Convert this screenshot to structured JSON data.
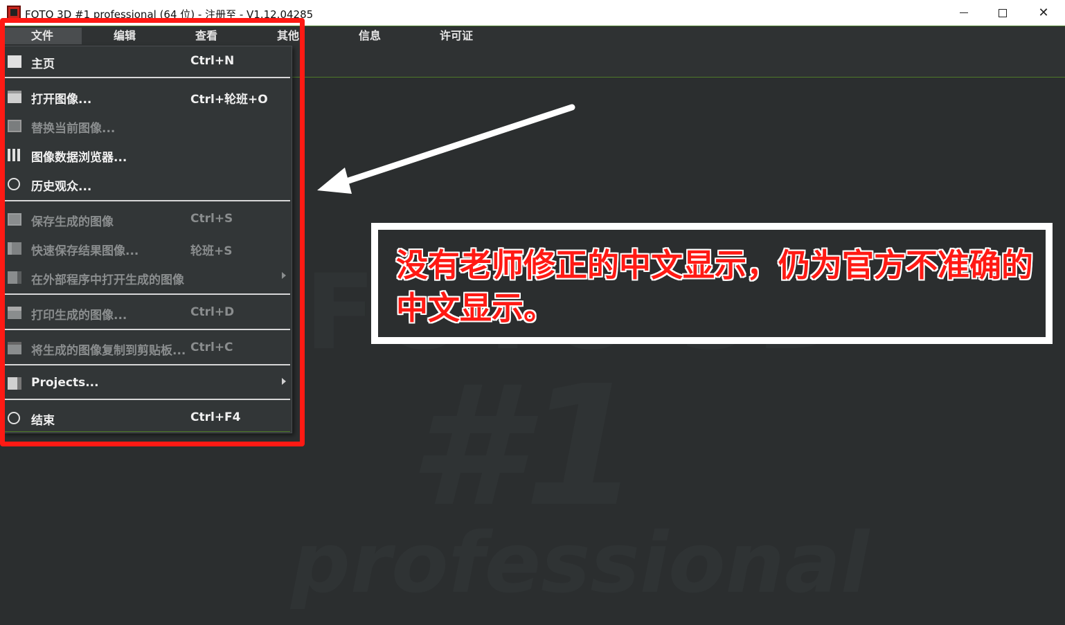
{
  "window": {
    "title": "FOTO 3D #1 professional (64 位) - 注册至 - V1.12.04285",
    "controls": {
      "minimize": "minimize-icon",
      "maximize": "maximize-icon",
      "close": "close-icon"
    }
  },
  "menubar": {
    "items": [
      {
        "label": "文件",
        "active": true
      },
      {
        "label": "编辑"
      },
      {
        "label": "查看"
      },
      {
        "label": "其他"
      },
      {
        "label": "信息"
      },
      {
        "label": "许可证"
      }
    ]
  },
  "background_logo": {
    "line1": "FOTO 3D",
    "line2": "#1",
    "line3": "professional"
  },
  "file_menu": {
    "items": [
      {
        "label": "主页",
        "shortcut": "Ctrl+N",
        "icon": "page-icon",
        "enabled": true
      },
      {
        "label": "打开图像...",
        "shortcut": "Ctrl+轮班+O",
        "icon": "folder-icon",
        "enabled": true
      },
      {
        "label": "替换当前图像...",
        "shortcut": "",
        "icon": "image-replace-icon",
        "enabled": false
      },
      {
        "label": "图像数据浏览器...",
        "shortcut": "",
        "icon": "grid-icon",
        "enabled": true
      },
      {
        "label": "历史观众...",
        "shortcut": "",
        "icon": "clock-icon",
        "enabled": true
      },
      {
        "label": "保存生成的图像",
        "shortcut": "Ctrl+S",
        "icon": "floppy-icon",
        "enabled": false
      },
      {
        "label": "快速保存结果图像...",
        "shortcut": "轮班+S",
        "icon": "floppy-fast-icon",
        "enabled": false
      },
      {
        "label": "在外部程序中打开生成的图像",
        "shortcut": "",
        "icon": "external-program-icon",
        "enabled": false,
        "submenu": true
      },
      {
        "label": "打印生成的图像...",
        "shortcut": "Ctrl+D",
        "icon": "printer-icon",
        "enabled": false
      },
      {
        "label": "将生成的图像复制到剪贴板...",
        "shortcut": "Ctrl+C",
        "icon": "clipboard-icon",
        "enabled": false
      },
      {
        "label": "Projects...",
        "shortcut": "",
        "icon": "projects-icon",
        "enabled": true,
        "submenu": true
      },
      {
        "label": "结束",
        "shortcut": "Ctrl+F4",
        "icon": "exit-icon",
        "enabled": true
      }
    ]
  },
  "annotation": {
    "text": "没有老师修正的中文显示，仍为官方不准确的中文显示。",
    "color": "#ff1a14",
    "frame_color": "#ff1a14",
    "arrow_color": "#ffffff"
  }
}
